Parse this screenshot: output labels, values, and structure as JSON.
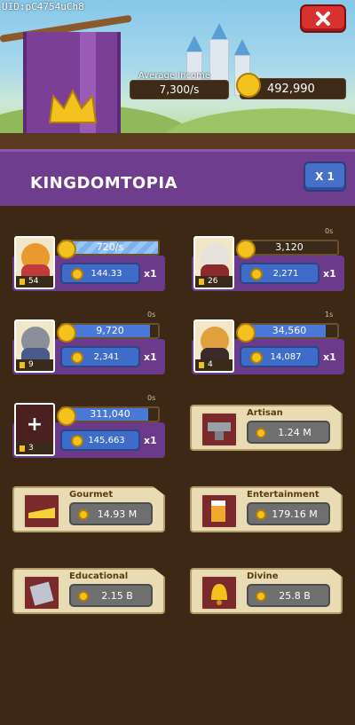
{
  "header": {
    "uid": "UID:pC4754uCh8",
    "average_income_label": "Average Income",
    "average_income_value": "7,300/s",
    "gold_amount": "492,990",
    "close_icon": "close-x-icon"
  },
  "title_bar": {
    "title": "KINGDOMTOPIA",
    "multiplier_button": "X 1"
  },
  "businesses": [
    {
      "timer": "",
      "progress_value": "720/s",
      "progress_fraction": 1.0,
      "level": "54",
      "upgrade_cost": "144.33",
      "multiplier": "x1",
      "portrait": "king-and-dragon-icon"
    },
    {
      "timer": "0s",
      "progress_value": "3,120",
      "progress_fraction": 0.0,
      "level": "26",
      "upgrade_cost": "2,271",
      "multiplier": "x1",
      "portrait": "knight-bear-icon"
    },
    {
      "timer": "0s",
      "progress_value": "9,720",
      "progress_fraction": 0.92,
      "level": "9",
      "upgrade_cost": "2,341",
      "multiplier": "x1",
      "portrait": "wolf-warrior-icon"
    },
    {
      "timer": "1s",
      "progress_value": "34,560",
      "progress_fraction": 0.88,
      "level": "4",
      "upgrade_cost": "14,087",
      "multiplier": "x1",
      "portrait": "pirate-cat-icon"
    },
    {
      "timer": "0s",
      "progress_value": "311,040",
      "progress_fraction": 0.9,
      "level": "3",
      "upgrade_cost": "145,663",
      "multiplier": "x1",
      "portrait": "plus-icon"
    }
  ],
  "locked_categories": [
    {
      "name": "Artisan",
      "price": "1.24 M",
      "icon": "anvil-icon"
    },
    {
      "name": "Gourmet",
      "price": "14.93 M",
      "icon": "cheese-icon"
    },
    {
      "name": "Entertainment",
      "price": "179.16 M",
      "icon": "beer-mug-icon"
    },
    {
      "name": "Educational",
      "price": "2.15 B",
      "icon": "book-icon"
    },
    {
      "name": "Divine",
      "price": "25.8 B",
      "icon": "bell-icon"
    }
  ],
  "colors": {
    "purple": "#6e3d8e",
    "blue_button": "#3e6cc8",
    "gold": "#f4c21e",
    "brown_bg": "#3d2715",
    "close_red": "#d93030"
  }
}
